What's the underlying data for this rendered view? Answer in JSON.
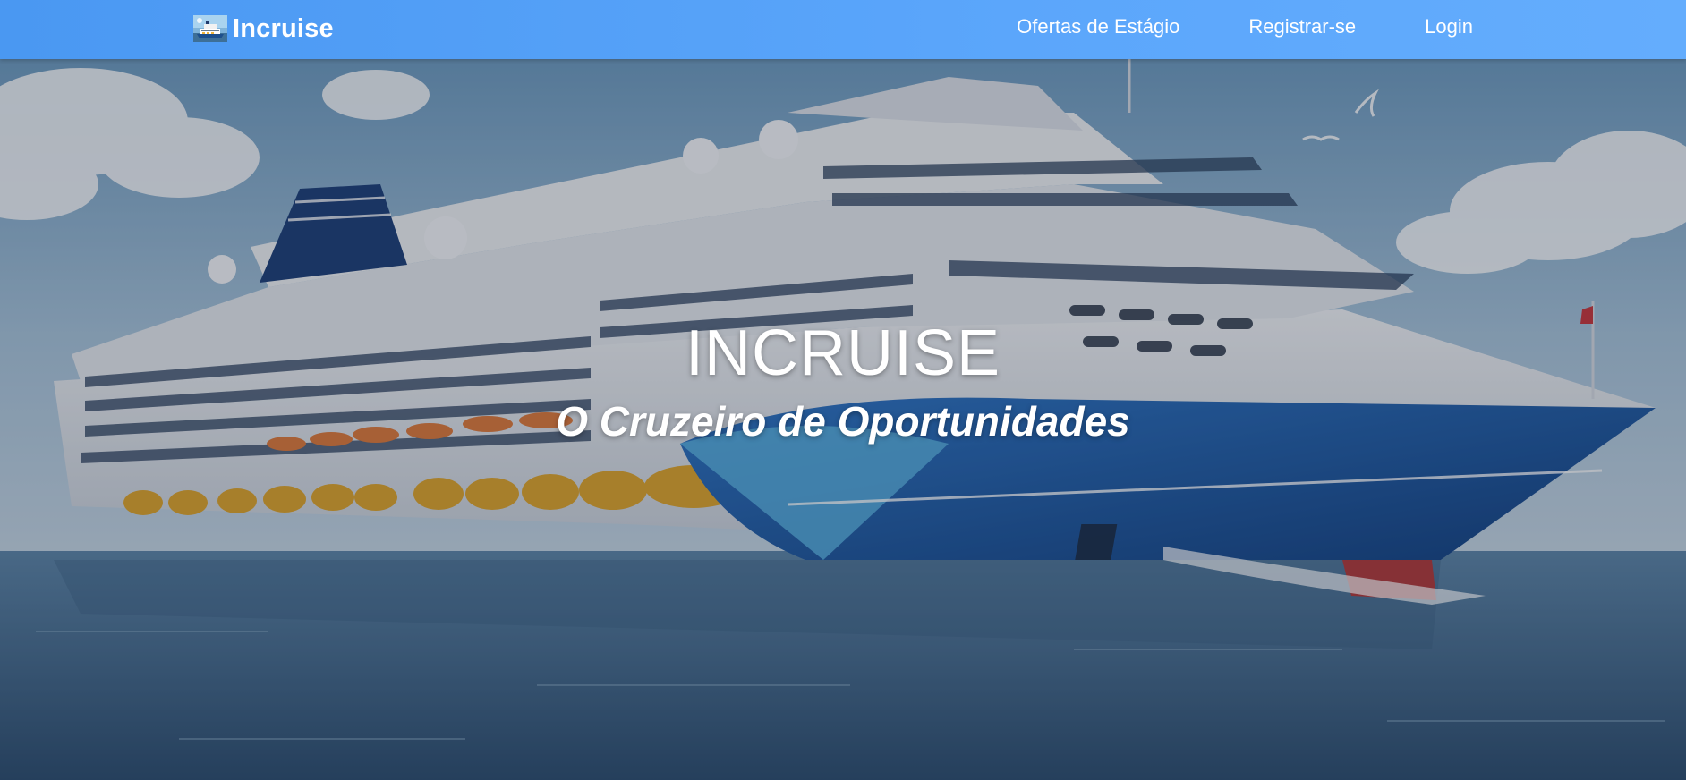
{
  "navbar": {
    "brand": {
      "name": "Incruise",
      "logo_icon": "cruise-ship-logo-icon"
    },
    "links": [
      {
        "label": "Ofertas de Estágio"
      },
      {
        "label": "Registrar-se"
      },
      {
        "label": "Login"
      }
    ],
    "background_color": "#5ba6fb"
  },
  "hero": {
    "title": "INCRUISE",
    "subtitle": "O Cruzeiro de Oportunidades",
    "background_image": "cruise-ship-illustration"
  }
}
